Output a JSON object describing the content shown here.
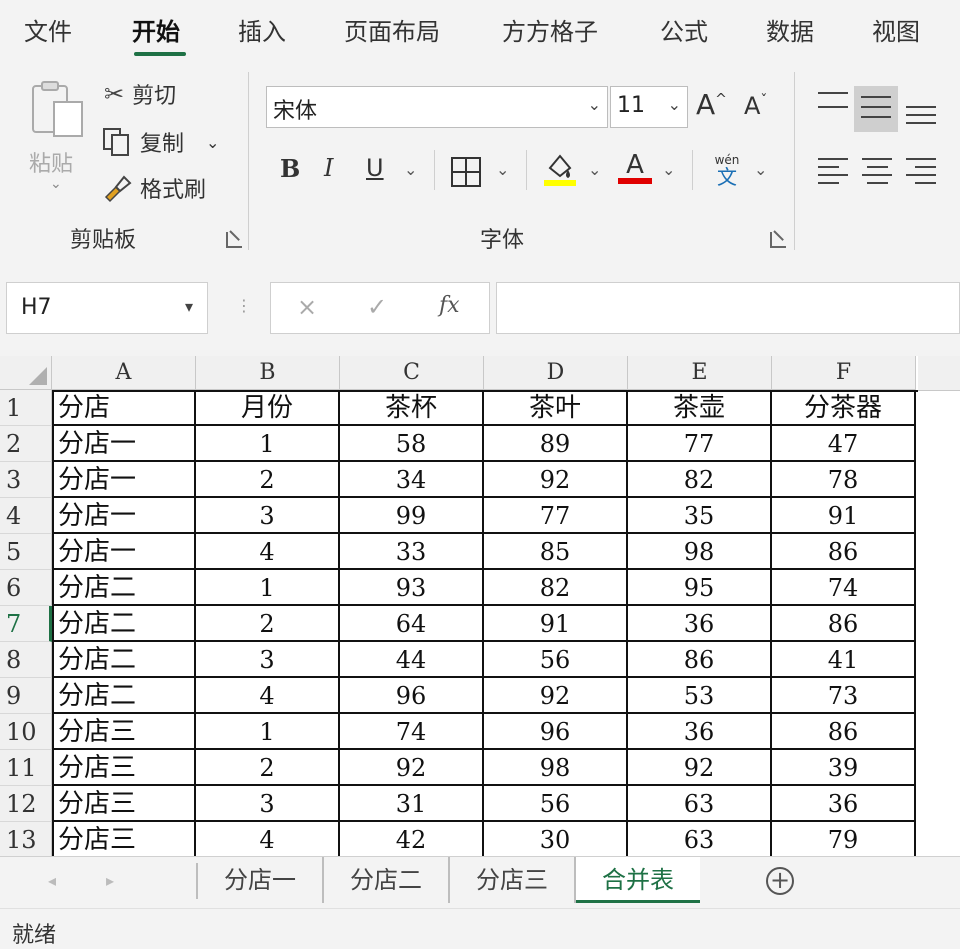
{
  "ribbon_tabs": [
    "文件",
    "开始",
    "插入",
    "页面布局",
    "方方格子",
    "公式",
    "数据",
    "视图"
  ],
  "active_tab": "开始",
  "clipboard": {
    "paste_label": "粘贴",
    "cut_label": "剪切",
    "copy_label": "复制",
    "format_painter_label": "格式刷",
    "group_label": "剪贴板"
  },
  "font": {
    "font_name": "宋体",
    "font_size": "11",
    "grow_label": "A",
    "shrink_label": "A",
    "bold_label": "B",
    "italic_label": "I",
    "underline_label": "U",
    "font_color_label": "A",
    "phonetic_top": "wén",
    "phonetic_bottom": "文",
    "group_label": "字体",
    "highlight_color": "#ffff00",
    "font_color": "#ff0000"
  },
  "formula_bar": {
    "name_box": "H7",
    "cancel_icon": "×",
    "enter_icon": "✓",
    "fx_label": "fx",
    "formula": ""
  },
  "sheet": {
    "columns": [
      "A",
      "B",
      "C",
      "D",
      "E",
      "F"
    ],
    "row_numbers": [
      "1",
      "2",
      "3",
      "4",
      "5",
      "6",
      "7",
      "8",
      "9",
      "10",
      "11",
      "12",
      "13"
    ],
    "selected_row": "7",
    "header": [
      "分店",
      "月份",
      "茶杯",
      "茶叶",
      "茶壶",
      "分茶器"
    ],
    "rows": [
      [
        "分店一",
        "1",
        "58",
        "89",
        "77",
        "47"
      ],
      [
        "分店一",
        "2",
        "34",
        "92",
        "82",
        "78"
      ],
      [
        "分店一",
        "3",
        "99",
        "77",
        "35",
        "91"
      ],
      [
        "分店一",
        "4",
        "33",
        "85",
        "98",
        "86"
      ],
      [
        "分店二",
        "1",
        "93",
        "82",
        "95",
        "74"
      ],
      [
        "分店二",
        "2",
        "64",
        "91",
        "36",
        "86"
      ],
      [
        "分店二",
        "3",
        "44",
        "56",
        "86",
        "41"
      ],
      [
        "分店二",
        "4",
        "96",
        "92",
        "53",
        "73"
      ],
      [
        "分店三",
        "1",
        "74",
        "96",
        "36",
        "86"
      ],
      [
        "分店三",
        "2",
        "92",
        "98",
        "92",
        "39"
      ],
      [
        "分店三",
        "3",
        "31",
        "56",
        "63",
        "36"
      ],
      [
        "分店三",
        "4",
        "42",
        "30",
        "63",
        "79"
      ]
    ]
  },
  "sheet_tabs": [
    "分店一",
    "分店二",
    "分店三",
    "合并表"
  ],
  "active_sheet": "合并表",
  "add_sheet_icon": "+",
  "status": "就绪",
  "accent_color": "#1e7145"
}
